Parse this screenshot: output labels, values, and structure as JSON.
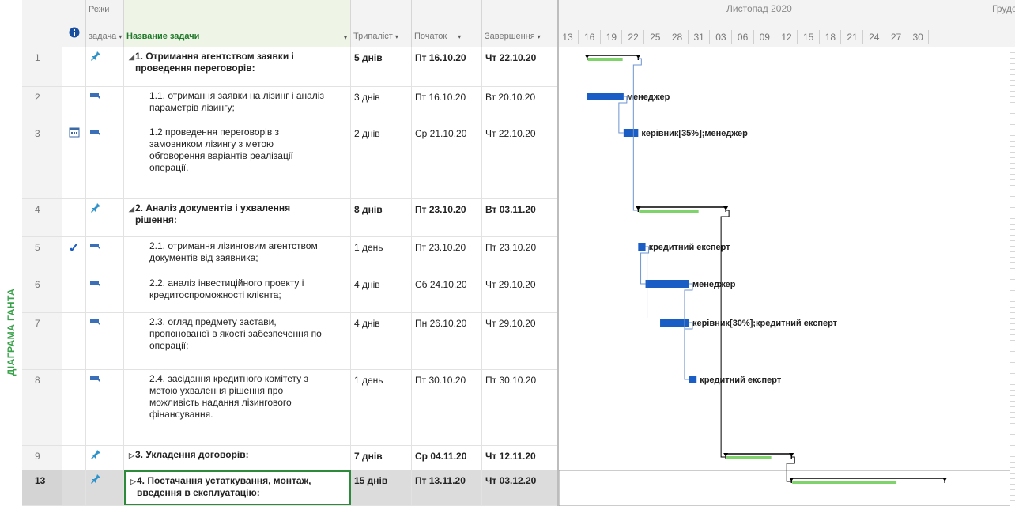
{
  "side_label": "ДІАГРАМА ГАНТА",
  "columns": {
    "indicators_icon": "info-icon",
    "mode": "Режи задач",
    "mode_line1": "Режи",
    "mode_line2": "задача",
    "task_name": "Название задачи",
    "duration": "Трипаліст",
    "start": "Початок",
    "finish": "Завершення"
  },
  "timeline": {
    "months": [
      "Листопад 2020",
      "Грудє"
    ],
    "days": [
      "13",
      "16",
      "19",
      "22",
      "25",
      "28",
      "31",
      "03",
      "06",
      "09",
      "12",
      "15",
      "18",
      "21",
      "24",
      "27",
      "30"
    ]
  },
  "rows": [
    {
      "id": "1",
      "summary": true,
      "level": 0,
      "mode_icon": "pin-icon",
      "indicator": "",
      "name_lines": [
        "1. Отримання агентством заявки і",
        "проведення переговорів:"
      ],
      "duration": "5 днів",
      "start": "Пт 16.10.20",
      "finish": "Чт 22.10.20"
    },
    {
      "id": "2",
      "summary": false,
      "level": 1,
      "mode_icon": "auto-schedule-icon",
      "indicator": "",
      "name_lines": [
        "1.1. отримання заявки на лізинг і аналіз",
        "параметрів лізингу;"
      ],
      "duration": "3 днів",
      "start": "Пт 16.10.20",
      "finish": "Вт 20.10.20",
      "resource": "менеджер"
    },
    {
      "id": "3",
      "summary": false,
      "level": 1,
      "mode_icon": "auto-schedule-icon",
      "indicator": "calendar-icon",
      "name_lines": [
        "1.2 проведення переговорів з",
        "замовником лізингу з метою",
        "обговорення варіантів реалізації",
        "операції."
      ],
      "duration": "2 днів",
      "start": "Ср 21.10.20",
      "finish": "Чт 22.10.20",
      "resource": "керівник[35%];менеджер"
    },
    {
      "id": "4",
      "summary": true,
      "level": 0,
      "mode_icon": "pin-icon",
      "indicator": "",
      "name_lines": [
        "2. Аналіз документів і ухвалення",
        "рішення:"
      ],
      "duration": "8 днів",
      "start": "Пт 23.10.20",
      "finish": "Вт 03.11.20"
    },
    {
      "id": "5",
      "summary": false,
      "level": 1,
      "mode_icon": "auto-schedule-icon",
      "indicator": "check-icon",
      "name_lines": [
        "2.1. отримання лізинговим агентством",
        "документів від заявника;"
      ],
      "duration": "1 день",
      "start": "Пт 23.10.20",
      "finish": "Пт 23.10.20",
      "resource": "кредитний експерт"
    },
    {
      "id": "6",
      "summary": false,
      "level": 1,
      "mode_icon": "auto-schedule-icon",
      "indicator": "",
      "name_lines": [
        "2.2. аналіз інвестиційного проекту і",
        "кредитоспроможності клієнта;"
      ],
      "duration": "4 днів",
      "start": "Сб 24.10.20",
      "finish": "Чт 29.10.20",
      "resource": "менеджер"
    },
    {
      "id": "7",
      "summary": false,
      "level": 1,
      "mode_icon": "auto-schedule-icon",
      "indicator": "",
      "name_lines": [
        "2.3. огляд предмету застави,",
        "пропонованої в якості забезпечення по",
        "операції;"
      ],
      "duration": "4 днів",
      "start": "Пн 26.10.20",
      "finish": "Чт 29.10.20",
      "resource": "керівник[30%];кредитний експерт"
    },
    {
      "id": "8",
      "summary": false,
      "level": 1,
      "mode_icon": "auto-schedule-icon",
      "indicator": "",
      "name_lines": [
        "2.4. засідання кредитного комітету з",
        "метою ухвалення рішення про",
        "можливість надання лізингового",
        "фінансування."
      ],
      "duration": "1 день",
      "start": "Пт 30.10.20",
      "finish": "Пт 30.10.20",
      "resource": "кредитний експерт"
    },
    {
      "id": "9",
      "summary": true,
      "level": 0,
      "collapsed": true,
      "mode_icon": "pin-icon",
      "indicator": "",
      "name_lines": [
        "3. Укладення договорів:"
      ],
      "duration": "7 днів",
      "start": "Ср 04.11.20",
      "finish": "Чт 12.11.20"
    },
    {
      "id": "13",
      "summary": true,
      "level": 0,
      "collapsed": true,
      "selected": true,
      "mode_icon": "pin-icon",
      "indicator": "",
      "name_lines": [
        "4. Постачання устаткування, монтаж,",
        "введення в експлуатацію:"
      ],
      "duration": "15 днів",
      "start": "Пт 13.11.20",
      "finish": "Чт 03.12.20"
    }
  ],
  "colors": {
    "task_bar": "#1a5dc4",
    "summary_bar": "#7ed36b",
    "summary_bracket": "#000000",
    "side_label": "#3aa24a",
    "task_header": "#1f7a2a"
  }
}
